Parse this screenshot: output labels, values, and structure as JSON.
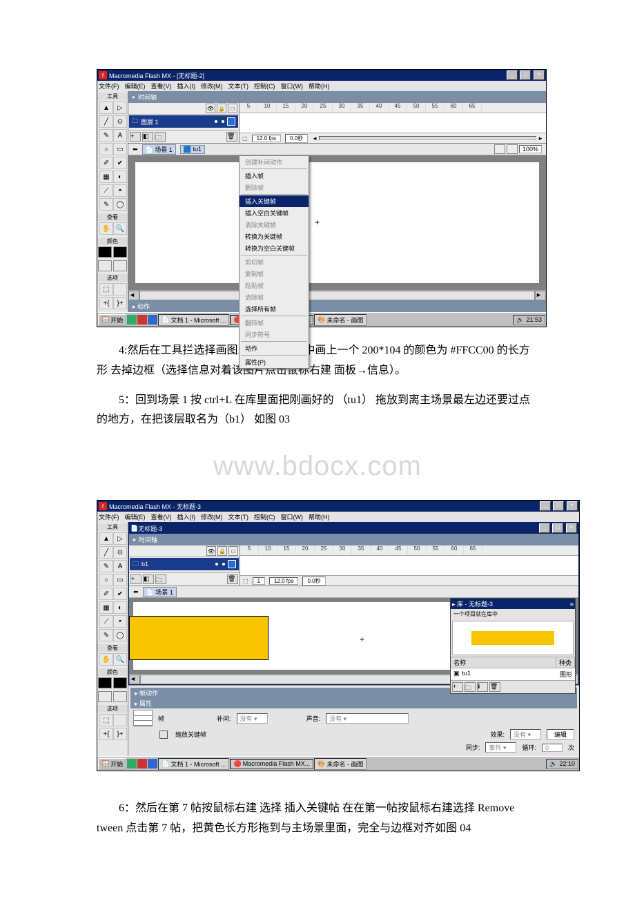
{
  "watermark": "www.bdocx.com",
  "para4": "4:然后在工具拦选择画图工具，在场景中画上一个 200*104 的颜色为 #FFCC00 的长方形 去掉边框（选择信息对着该图片点击鼠标右建 面板→信息）。",
  "para5": "5：回到场景 1 按 ctrl+L 在库里面把刚画好的 （tu1） 拖放到离主场景最左边还要过点的地方，在把该层取名为（b1） 如图 03",
  "para6": "6：然后在第 7 帖按鼠标右建 选择 插入关键帖 在在第一帖按鼠标右建选择 Remove tween 点击第 7 帖，把黄色长方形拖到与主场景里面，完全与边框对齐如图 04",
  "s1": {
    "title": "Macromedia Flash MX - [无标题-2]",
    "menu": [
      "文件(F)",
      "编辑(E)",
      "查看(V)",
      "插入(I)",
      "修改(M)",
      "文本(T)",
      "控制(C)",
      "窗口(W)",
      "帮助(H)"
    ],
    "tools_label": "工具",
    "view_label": "查看",
    "color_label": "颜色",
    "options_label": "选项",
    "timeline_label": "时间轴",
    "layer": "图层 1",
    "ruler": [
      "5",
      "10",
      "15",
      "20",
      "25",
      "30",
      "35",
      "40",
      "45",
      "50",
      "55",
      "60",
      "65"
    ],
    "fps": "12.0 fps",
    "time": "0.0秒",
    "crumb_scene": "场景 1",
    "crumb_sym": "tu1",
    "zoom": "100%",
    "ctx": {
      "i1": "创建补间动作",
      "i2": "插入帧",
      "i3": "删除帧",
      "i4": "插入关键帧",
      "i5": "插入空白关键帧",
      "i6": "清除关键帧",
      "i7": "转换为关键帧",
      "i8": "转换为空白关键帧",
      "i9": "剪切帧",
      "i10": "复制帧",
      "i11": "粘贴帧",
      "i12": "清除帧",
      "i13": "选择所有帧",
      "i14": "翻转帧",
      "i15": "同步符号",
      "i16": "动作",
      "i17": "属性(P)"
    },
    "actions_label": "动作",
    "taskbar": {
      "start": "开始",
      "item1": "文档 1 - Microsoft ...",
      "item2": "Macromedia Flash MX...",
      "item3": "未命名 - 画图",
      "clock": "21:53"
    }
  },
  "s2": {
    "title": "Macromedia Flash MX - 无标题-3",
    "menu": [
      "文件(F)",
      "编辑(E)",
      "查看(V)",
      "插入(I)",
      "修改(M)",
      "文本(T)",
      "控制(C)",
      "窗口(W)",
      "帮助(H)"
    ],
    "doc_tab": "无标题-3",
    "tools_label": "工具",
    "view_label": "查看",
    "color_label": "颜色",
    "options_label": "选项",
    "timeline_label": "时间轴",
    "layer": "b1",
    "ruler": [
      "5",
      "10",
      "15",
      "20",
      "25",
      "30",
      "35",
      "40",
      "45",
      "50",
      "55",
      "60",
      "65"
    ],
    "frame": "1",
    "fps": "12.0 fps",
    "time": "0.0秒",
    "crumb_scene": "场景 1",
    "lib": {
      "title": "库 - 无标题-3",
      "count": "一个项目就在库中",
      "col_name": "名称",
      "col_type": "种类",
      "item": "tu1",
      "itemtype": "图形"
    },
    "panel_frame": "帧动作",
    "panel_prop": "属性",
    "frame_label": "帧",
    "tween_label": "补间:",
    "tween_val": "没有",
    "chk_label": "缩放关键帧",
    "snd_label": "声音:",
    "snd_val": "没有",
    "fx_label": "效果:",
    "fx_val": "没有",
    "fx_btn": "编辑",
    "sync_label": "同步:",
    "sync_val": "事件",
    "loop_label": "循环:",
    "loop_n": "0",
    "loop_unit": "次",
    "taskbar": {
      "start": "开始",
      "item1": "文档 1 - Microsoft ...",
      "item2": "Macromedia Flash MX...",
      "item3": "未命名 - 画图",
      "clock": "22:10"
    }
  }
}
